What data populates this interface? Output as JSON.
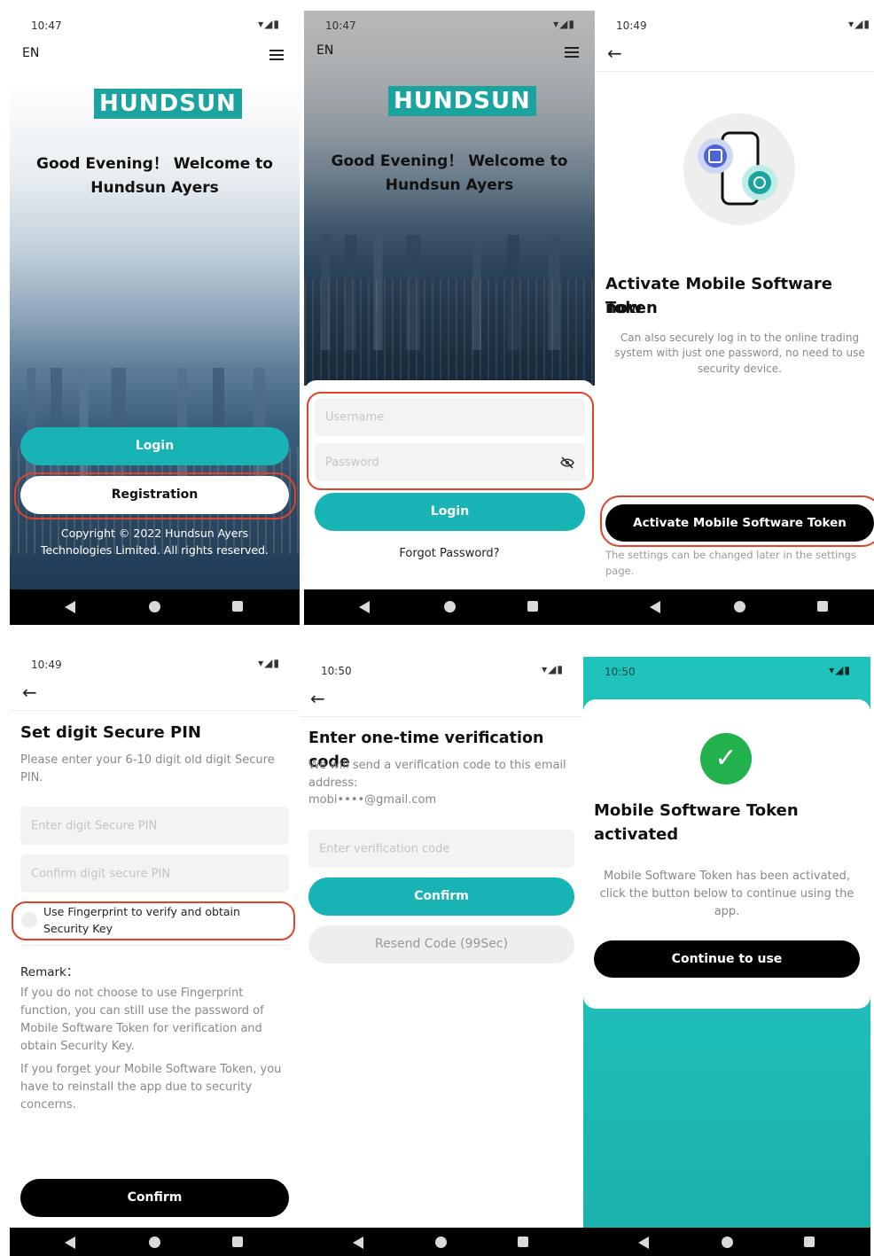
{
  "status": {
    "p1_time": "10:47",
    "p2_time": "10:47",
    "p3_time": "10:49",
    "p4_time": "10:49",
    "p5_time": "10:50",
    "p6_time": "10:50",
    "icons": "▾◢▮"
  },
  "screen1": {
    "language": "EN",
    "logo_text": "HUNDSUN",
    "greeting_line1": "Good Evening！ Welcome to",
    "greeting_line2": "Hundsun Ayers",
    "login_label": "Login",
    "registration_label": "Registration",
    "copyright_line1": "Copyright © 2022 Hundsun Ayers",
    "copyright_line2": "Technologies Limited. All rights reserved."
  },
  "screen2": {
    "language": "EN",
    "logo_text": "HUNDSUN",
    "greeting_line1": "Good Evening！ Welcome to",
    "greeting_line2": "Hundsun Ayers",
    "username_placeholder": "Username",
    "password_placeholder": "Password",
    "login_label": "Login",
    "forgot_label": "Forgot Password?"
  },
  "screen3": {
    "title_line1": "Activate Mobile Software Token",
    "title_line2": "now",
    "desc_line1": "Can also securely log in to the online trading",
    "desc_line2": "system with just one password, no need to use",
    "desc_line3": "security device.",
    "activate_label": "Activate Mobile Software Token",
    "note_line1": "The settings can be changed later in the settings",
    "note_line2": "page."
  },
  "screen4": {
    "title": "Set digit Secure PIN",
    "desc_line1": "Please enter your 6-10 digit old digit Secure",
    "desc_line2": "PIN.",
    "pin_placeholder": "Enter digit Secure PIN",
    "confirm_pin_placeholder": "Confirm digit secure PIN",
    "fingerprint_line1": "Use  Fingerprint  to verify and obtain",
    "fingerprint_line2": "Security Key",
    "remark_title": "Remark：",
    "remark1_line1": "If you do not choose to use  Fingerprint",
    "remark1_line2": "function, you can still use the password of",
    "remark1_line3": "Mobile Software Token for verification and",
    "remark1_line4": "obtain Security Key.",
    "remark2_line1": "If you forget your Mobile Software Token, you",
    "remark2_line2": "have to reinstall the app due to security",
    "remark2_line3": "concerns.",
    "confirm_label": "Confirm"
  },
  "screen5": {
    "title": "Enter one-time verification code",
    "desc_line1": "We will send a verification code to this email",
    "desc_line2": "address:",
    "email": "mobi••••@gmail.com",
    "code_placeholder": "Enter verification code",
    "confirm_label": "Confirm",
    "resend_label": "Resend Code (99Sec)"
  },
  "screen6": {
    "title_line1": "Mobile Software Token",
    "title_line2": "activated",
    "desc_line1": "Mobile Software Token has been activated,",
    "desc_line2": "click the button below to continue using the",
    "desc_line3": "app.",
    "continue_label": "Continue to use",
    "check_glyph": "✓"
  },
  "colors": {
    "teal": "#17b3b5",
    "highlight_red": "#e0432b",
    "success_green": "#22b14c"
  }
}
